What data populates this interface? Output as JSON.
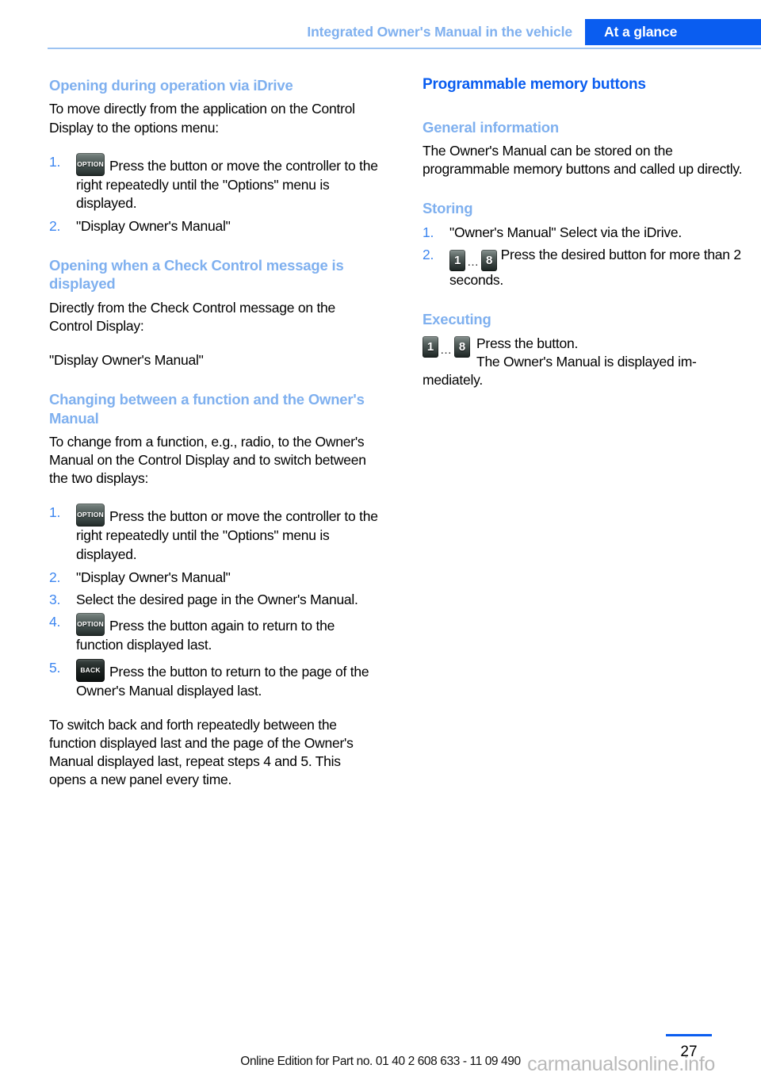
{
  "header": {
    "chapter": "Integrated Owner's Manual in the vehicle",
    "section": "At a glance",
    "chapter_color": "#7fb0ef",
    "section_bg": "#0a5df0",
    "rule_color": "#9cc3f2"
  },
  "colors": {
    "heading_primary": "#0a5df0",
    "heading_secondary": "#7fb0ef",
    "list_number": "#3d86f0",
    "body_text": "#000000",
    "watermark": "#b9b9b9"
  },
  "left_column": {
    "section1": {
      "title": "Opening during operation via iDrive",
      "intro": "To move directly from the application on the Control Display to the options menu:",
      "steps": [
        {
          "number": "1.",
          "icon": "option-button-icon",
          "icon_label": "OPTION",
          "text": "Press the button or move the controller to the right repeatedly until the \"Options\" menu is displayed."
        },
        {
          "number": "2.",
          "icon": null,
          "icon_label": null,
          "text": "\"Display Owner's Manual\""
        }
      ]
    },
    "section2": {
      "title": "Opening when a Check Control message is displayed",
      "intro": "Directly from the Check Control message on the Control Display:",
      "body": "\"Display Owner's Manual\""
    },
    "section3": {
      "title": "Changing between a function and the Owner's Manual",
      "intro": "To change from a function, e.g., radio, to the Owner's Manual on the Control Display and to switch between the two displays:",
      "steps": [
        {
          "number": "1.",
          "icon": "option-button-icon",
          "icon_label": "OPTION",
          "text": "Press the button or move the controller to the right repeatedly until the \"Options\" menu is displayed."
        },
        {
          "number": "2.",
          "icon": null,
          "icon_label": null,
          "text": "\"Display Owner's Manual\""
        },
        {
          "number": "3.",
          "icon": null,
          "icon_label": null,
          "text": "Select the desired page in the Owner's Manual."
        },
        {
          "number": "4.",
          "icon": "option-button-icon",
          "icon_label": "OPTION",
          "text": "Press the button again to return to the function displayed last."
        },
        {
          "number": "5.",
          "icon": "back-button-icon",
          "icon_label": "BACK",
          "text": "Press the button to return to the page of the Owner's Manual displayed last."
        }
      ],
      "closing": "To switch back and forth repeatedly between the function displayed last and the page of the Owner's Manual displayed last, repeat steps 4 and 5. This opens a new panel every time."
    }
  },
  "right_column": {
    "title": "Programmable memory buttons",
    "general": {
      "title": "General information",
      "body": "The Owner's Manual can be stored on the programmable memory buttons and called up directly."
    },
    "storing": {
      "title": "Storing",
      "steps": [
        {
          "number": "1.",
          "icon": null,
          "text": "\"Owner's Manual\" Select via the iDrive."
        },
        {
          "number": "2.",
          "icon": "memory-buttons-icon",
          "text": "Press the desired button for more than 2 seconds."
        }
      ]
    },
    "executing": {
      "title": "Executing",
      "icon": "memory-buttons-icon",
      "line1": "Press the button.",
      "line2": "The Owner's Manual is displayed im-",
      "line3": "mediately."
    }
  },
  "memory_buttons": {
    "first": "1",
    "ellipsis": "…",
    "last": "8"
  },
  "footer": {
    "page_number": "27",
    "edition_line": "Online Edition for Part no. 01 40 2 608 633 - 11 09 490",
    "watermark": "carmanualsonline.info"
  }
}
